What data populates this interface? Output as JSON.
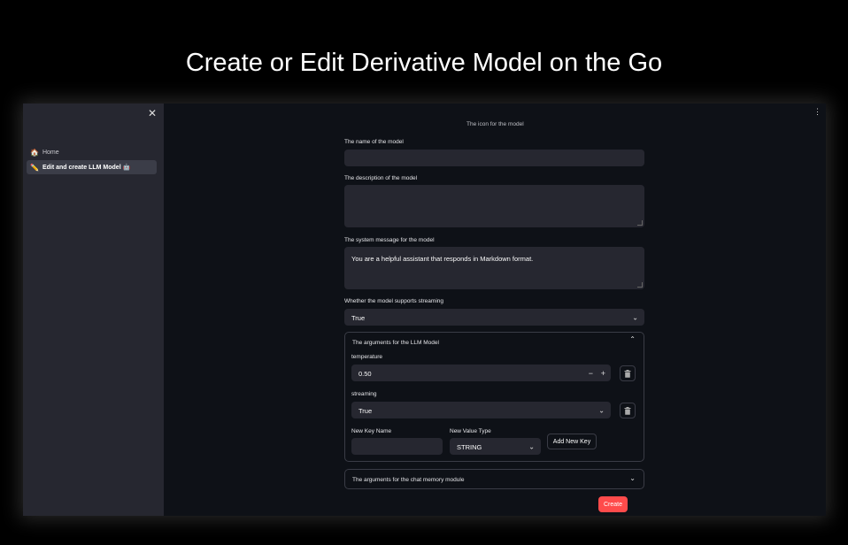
{
  "banner": {
    "title": "Create or Edit Derivative Model on the Go"
  },
  "sidebar": {
    "close_glyph": "✕",
    "items": [
      {
        "icon": "🏠",
        "label": "Home"
      },
      {
        "icon": "✏️",
        "label": "Edit and create LLM Model 🤖"
      }
    ]
  },
  "header": {
    "menu_glyph": "⋮"
  },
  "form": {
    "icon_caption": "The icon for the model",
    "name_label": "The name of the model",
    "name_value": "",
    "description_label": "The description of the model",
    "description_value": "",
    "system_label": "The system message for the model",
    "system_value": "You are a helpful assistant that responds in Markdown format.",
    "streaming_label": "Whether the model supports streaming",
    "streaming_value": "True",
    "llm_args": {
      "title": "The arguments for the LLM Model",
      "temperature_label": "temperature",
      "temperature_value": "0.50",
      "minus": "−",
      "plus": "+",
      "streaming_label": "streaming",
      "streaming_value": "True",
      "new_key_label": "New Key Name",
      "new_key_value": "",
      "new_type_label": "New Value Type",
      "new_type_value": "STRING",
      "add_button": "Add New Key"
    },
    "memory_args": {
      "title": "The arguments for the chat memory module"
    },
    "create_button": "Create"
  },
  "colors": {
    "accent": "#ff4b4b",
    "background": "#0e1117",
    "sidebar": "#262730"
  }
}
